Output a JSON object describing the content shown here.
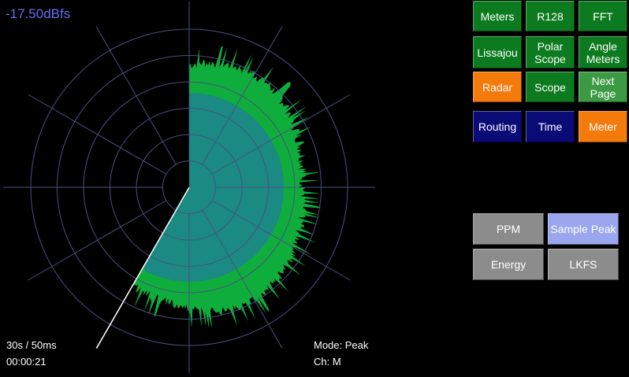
{
  "readout": {
    "level": "-17.50dBfs"
  },
  "info": {
    "timebase": "30s / 50ms",
    "elapsed": "00:00:21",
    "mode": "Mode: Peak",
    "channel": "Ch: M"
  },
  "nav": {
    "meters": "Meters",
    "r128": "R128",
    "fft": "FFT",
    "lissajou": "Lissajou",
    "polar_scope": "Polar\nScope",
    "angle_meters": "Angle\nMeters",
    "radar": "Radar",
    "scope": "Scope",
    "next_page": "Next\nPage",
    "routing": "Routing",
    "time": "Time",
    "meter": "Meter"
  },
  "meter_type": {
    "ppm": "PPM",
    "sample_peak": "Sample Peak",
    "energy": "Energy",
    "lkfs": "LKFS"
  },
  "radar": {
    "rings": 6,
    "spokes": 12,
    "sweep_fraction": 0.583,
    "colors": {
      "grid": "#4a5080",
      "peak": "#0fae3c",
      "average": "#1a8a82",
      "sweep": "#ffffff"
    }
  }
}
